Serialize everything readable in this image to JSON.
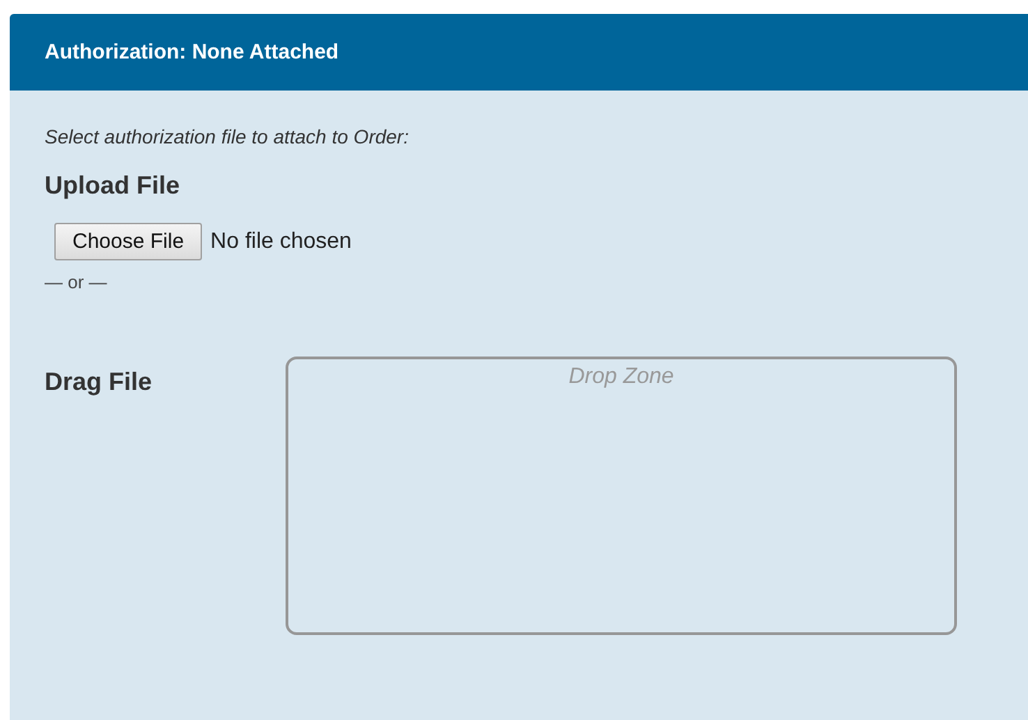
{
  "panel": {
    "title": "Authorization: None Attached"
  },
  "instruction": "Select authorization file to attach to Order:",
  "upload": {
    "heading": "Upload File",
    "button": "Choose File",
    "status": "No file chosen"
  },
  "separator": "— or —",
  "drag": {
    "heading": "Drag File",
    "drop_zone": "Drop Zone"
  }
}
